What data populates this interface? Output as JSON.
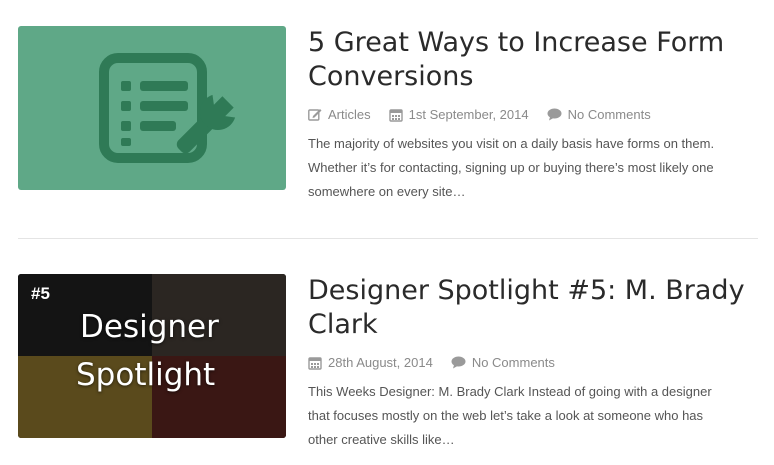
{
  "posts": [
    {
      "title": "5 Great Ways to Increase Form Conversions",
      "category": "Articles",
      "date": "1st September, 2014",
      "comments": "No Comments",
      "excerpt": "The majority of websites you visit on a daily basis have forms on them. Whether it’s for contacting, signing up or buying there’s most likely one somewhere on every site…",
      "thumbnail_icon": "form-wrench-icon",
      "thumbnail_color": "#5fa887"
    },
    {
      "title": "Designer Spotlight #5: M. Brady Clark",
      "date": "28th August, 2014",
      "comments": "No Comments",
      "excerpt": "This Weeks Designer: M. Brady Clark Instead of going with a designer that focuses mostly on the web let’s take a look at someone who has other creative skills like…",
      "thumbnail_number": "#5",
      "thumbnail_line1": "Designer",
      "thumbnail_line2": "Spotlight"
    }
  ],
  "colors": {
    "meta_text": "#8a8a8a",
    "title_text": "#2a2a2a",
    "divider": "#e4e4e4"
  }
}
